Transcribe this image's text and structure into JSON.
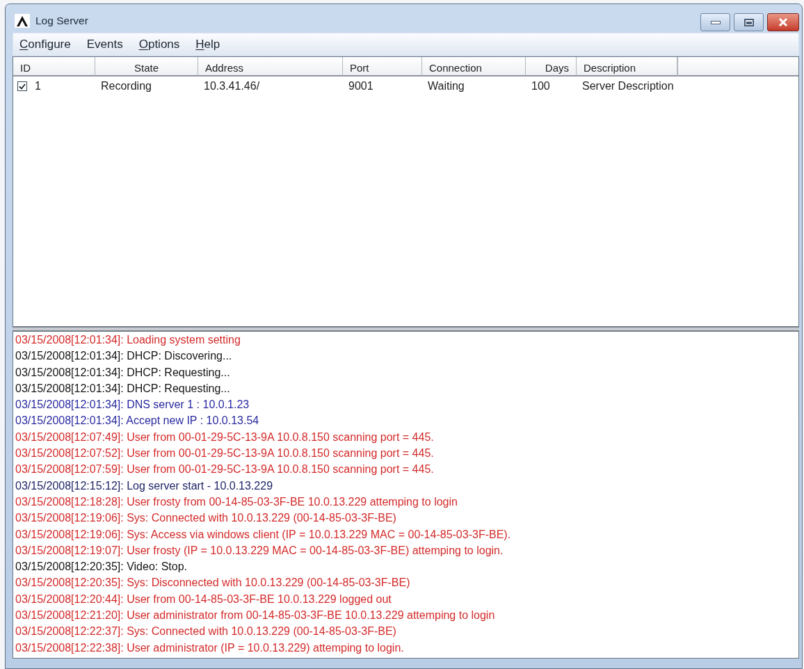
{
  "window": {
    "title": "Log Server"
  },
  "menu": [
    {
      "label": "Configure",
      "mnemonic": true
    },
    {
      "label": "Events",
      "mnemonic": false
    },
    {
      "label": "Options",
      "mnemonic": true
    },
    {
      "label": "Help",
      "mnemonic": true
    }
  ],
  "servers": {
    "columns": [
      "ID",
      "State",
      "Address",
      "Port",
      "Connection",
      "Days",
      "Description"
    ],
    "rows": [
      {
        "checked": true,
        "cells": [
          "1",
          "Recording",
          "10.3.41.46/",
          "9001",
          "Waiting",
          "100",
          "Server Description"
        ]
      }
    ]
  },
  "log": [
    {
      "text": "03/15/2008[12:01:34]: Loading system setting",
      "color": "#d42a2a"
    },
    {
      "text": "03/15/2008[12:01:34]: DHCP: Discovering...",
      "color": "#141414"
    },
    {
      "text": "03/15/2008[12:01:34]: DHCP: Requesting...",
      "color": "#141414"
    },
    {
      "text": "03/15/2008[12:01:34]: DHCP: Requesting...",
      "color": "#141414"
    },
    {
      "text": "03/15/2008[12:01:34]: DNS server 1 : 10.0.1.23",
      "color": "#2a2aa0"
    },
    {
      "text": "03/15/2008[12:01:34]: Accept new IP : 10.0.13.54",
      "color": "#2a2aa0"
    },
    {
      "text": "03/15/2008[12:07:49]: User from 00-01-29-5C-13-9A 10.0.8.150 scanning port = 445.",
      "color": "#d42a2a"
    },
    {
      "text": "03/15/2008[12:07:52]: User from 00-01-29-5C-13-9A 10.0.8.150 scanning port = 445.",
      "color": "#d42a2a"
    },
    {
      "text": "03/15/2008[12:07:59]: User from 00-01-29-5C-13-9A 10.0.8.150 scanning port = 445.",
      "color": "#d42a2a"
    },
    {
      "text": "03/15/2008[12:15:12]: Log server start - 10.0.13.229",
      "color": "#1e2566"
    },
    {
      "text": "03/15/2008[12:18:28]: User frosty from 00-14-85-03-3F-BE 10.0.13.229 attemping to login",
      "color": "#d42a2a"
    },
    {
      "text": "03/15/2008[12:19:06]: Sys: Connected with 10.0.13.229 (00-14-85-03-3F-BE)",
      "color": "#d42a2a"
    },
    {
      "text": "03/15/2008[12:19:06]: Sys: Access via windows client (IP = 10.0.13.229 MAC = 00-14-85-03-3F-BE).",
      "color": "#d42a2a"
    },
    {
      "text": "03/15/2008[12:19:07]: User frosty (IP = 10.0.13.229 MAC = 00-14-85-03-3F-BE) attemping to login.",
      "color": "#d42a2a"
    },
    {
      "text": "03/15/2008[12:20:35]: Video: Stop.",
      "color": "#141414"
    },
    {
      "text": "03/15/2008[12:20:35]: Sys: Disconnected with 10.0.13.229 (00-14-85-03-3F-BE)",
      "color": "#d42a2a"
    },
    {
      "text": "03/15/2008[12:20:44]: User from 00-14-85-03-3F-BE 10.0.13.229 logged out",
      "color": "#d42a2a"
    },
    {
      "text": "03/15/2008[12:21:20]: User administrator from 00-14-85-03-3F-BE 10.0.13.229 attemping to login",
      "color": "#d42a2a"
    },
    {
      "text": "03/15/2008[12:22:37]: Sys: Connected with 10.0.13.229 (00-14-85-03-3F-BE)",
      "color": "#d42a2a"
    },
    {
      "text": "03/15/2008[12:22:38]: User administrator (IP = 10.0.13.229) attemping to login.",
      "color": "#d42a2a"
    }
  ]
}
